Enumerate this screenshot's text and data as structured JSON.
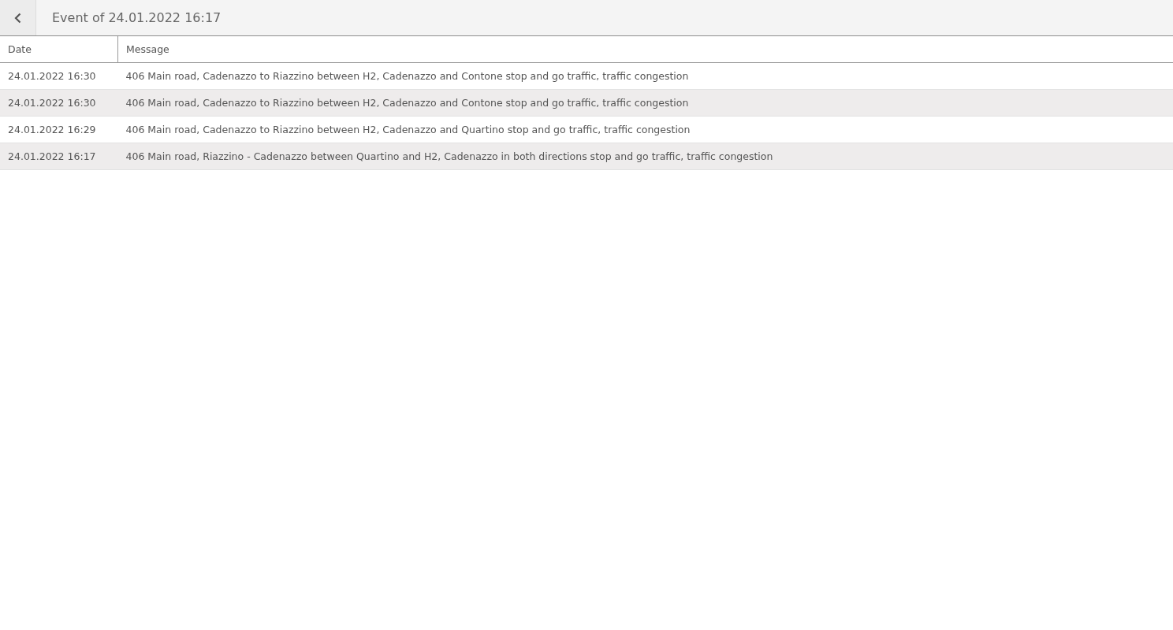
{
  "header": {
    "title": "Event of 24.01.2022 16:17"
  },
  "table": {
    "columns": [
      "Date",
      "Message"
    ],
    "rows": [
      {
        "date": "24.01.2022 16:30",
        "message": "406 Main road, Cadenazzo to Riazzino between H2, Cadenazzo and Contone stop and go traffic, traffic congestion"
      },
      {
        "date": "24.01.2022 16:30",
        "message": "406 Main road, Cadenazzo to Riazzino between H2, Cadenazzo and Contone stop and go traffic, traffic congestion"
      },
      {
        "date": "24.01.2022 16:29",
        "message": "406 Main road, Cadenazzo to Riazzino between H2, Cadenazzo and Quartino stop and go traffic, traffic congestion"
      },
      {
        "date": "24.01.2022 16:17",
        "message": "406 Main road, Riazzino - Cadenazzo between Quartino and H2, Cadenazzo in both directions stop and go traffic, traffic congestion"
      }
    ]
  }
}
